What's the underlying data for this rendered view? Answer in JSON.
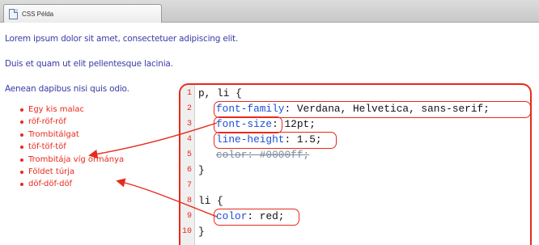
{
  "tab": {
    "title": "CSS Példa",
    "icon": "page-icon"
  },
  "content": {
    "paragraphs": [
      "Lorem ipsum dolor sit amet, consectetuer adipiscing elit.",
      "Duis et quam ut elit pellentesque lacinia.",
      "Aenean dapibus nisi quis odio."
    ],
    "list_items": [
      "Egy kis malac",
      "röf-röf-röf",
      "Trombitálgat",
      "töf-töf-töf",
      "Trombitája víg ormánya",
      "Földet túrja",
      "döf-döf-döf"
    ]
  },
  "code": {
    "line_numbers": [
      "1",
      "2",
      "3",
      "4",
      "5",
      "6",
      "7",
      "8",
      "9",
      "10"
    ],
    "l1": "p, li {",
    "l2_prop": "font-family",
    "l2_val": ": Verdana, Helvetica, sans-serif;",
    "l3_prop": "font-size",
    "l3_val": ": 12pt;",
    "l4_prop": "line-height",
    "l4_val": ": 1.5;",
    "l5": "color: #0000ff;",
    "l6": "}",
    "l8": "li {",
    "l9_prop": "color",
    "l9_val": ": red;",
    "l10": "}"
  },
  "colors": {
    "accent_red": "#e8291b",
    "paragraph_blue": "#3a3aa8",
    "property_blue": "#1a4fd6"
  }
}
